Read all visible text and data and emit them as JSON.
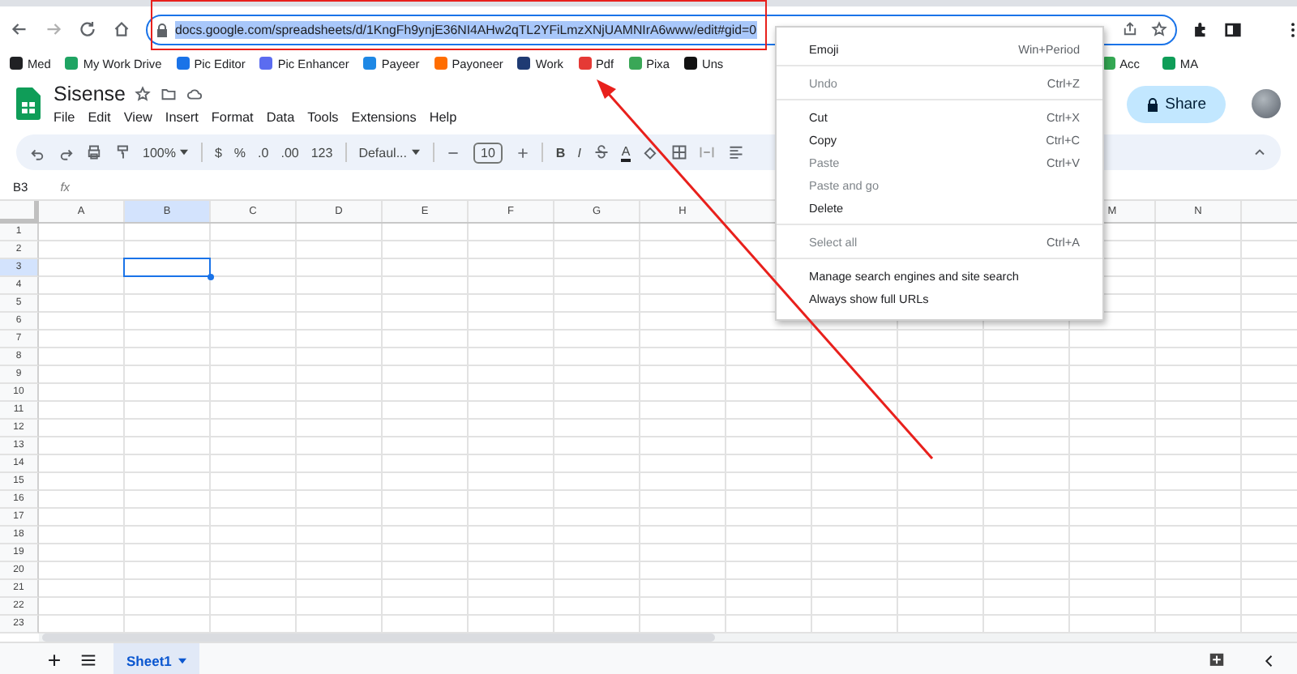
{
  "browser": {
    "url": "docs.google.com/spreadsheets/d/1KngFh9ynjE36NI4AHw2qTL2YFiLmzXNjUAMNIrA6www/edit#gid=0",
    "url_selected": true
  },
  "bookmarks": [
    {
      "label": "Med",
      "color": "#202124"
    },
    {
      "label": "My Work Drive",
      "color": "#1fa463"
    },
    {
      "label": "Pic Editor",
      "color": "#1a73e8"
    },
    {
      "label": "Pic Enhancer",
      "color": "#5b6cf0"
    },
    {
      "label": "Payeer",
      "color": "#1e88e5"
    },
    {
      "label": "Payoneer",
      "color": "#ff6d00"
    },
    {
      "label": "Work",
      "color": "#1f3b73"
    },
    {
      "label": "Pdf",
      "color": "#e53935"
    },
    {
      "label": "Pixa",
      "color": "#3aa757"
    },
    {
      "label": "Uns",
      "color": "#111111"
    }
  ],
  "bookmarks_right": [
    {
      "label": "Acc",
      "color": "#34a853"
    },
    {
      "label": "MA",
      "color": "#0f9d58"
    }
  ],
  "sheets": {
    "title": "Sisense",
    "menus": [
      "File",
      "Edit",
      "View",
      "Insert",
      "Format",
      "Data",
      "Tools",
      "Extensions",
      "Help"
    ],
    "share": "Share"
  },
  "toolbar": {
    "zoom": "100%",
    "currency": "$",
    "percent": "%",
    "decrease_decimals": ".0",
    "increase_decimals": ".00",
    "number_format": "123",
    "font": "Defaul...",
    "font_size": "10",
    "bold": "B",
    "italic": "I",
    "text_color": "A"
  },
  "formula_bar": {
    "name_box": "B3",
    "fx": "fx"
  },
  "grid": {
    "columns": [
      {
        "label": "A",
        "selected": false
      },
      {
        "label": "B",
        "selected": true
      },
      {
        "label": "C",
        "selected": false
      },
      {
        "label": "D",
        "selected": false
      },
      {
        "label": "E",
        "selected": false
      },
      {
        "label": "F",
        "selected": false
      },
      {
        "label": "G",
        "selected": false
      },
      {
        "label": "H",
        "selected": false
      }
    ],
    "columns_right": [
      {
        "label": "M",
        "selected": false
      },
      {
        "label": "N",
        "selected": false
      }
    ],
    "rows": [
      {
        "label": "1",
        "selected": false
      },
      {
        "label": "2",
        "selected": false
      },
      {
        "label": "3",
        "selected": true
      },
      {
        "label": "4",
        "selected": false
      },
      {
        "label": "5",
        "selected": false
      },
      {
        "label": "6",
        "selected": false
      },
      {
        "label": "7",
        "selected": false
      },
      {
        "label": "8",
        "selected": false
      },
      {
        "label": "9",
        "selected": false
      },
      {
        "label": "10",
        "selected": false
      },
      {
        "label": "11",
        "selected": false
      },
      {
        "label": "12",
        "selected": false
      },
      {
        "label": "13",
        "selected": false
      },
      {
        "label": "14",
        "selected": false
      },
      {
        "label": "15",
        "selected": false
      },
      {
        "label": "16",
        "selected": false
      },
      {
        "label": "17",
        "selected": false
      },
      {
        "label": "18",
        "selected": false
      },
      {
        "label": "19",
        "selected": false
      },
      {
        "label": "20",
        "selected": false
      },
      {
        "label": "21",
        "selected": false
      },
      {
        "label": "22",
        "selected": false
      },
      {
        "label": "23",
        "selected": false
      }
    ]
  },
  "sheet_tabs": [
    {
      "label": "Sheet1",
      "selected": true
    }
  ],
  "context_menu": [
    [
      {
        "label": "Emoji",
        "shortcut": "Win+Period",
        "disabled": false
      }
    ],
    [
      {
        "label": "Undo",
        "shortcut": "Ctrl+Z",
        "disabled": true
      }
    ],
    [
      {
        "label": "Cut",
        "shortcut": "Ctrl+X",
        "disabled": false
      },
      {
        "label": "Copy",
        "shortcut": "Ctrl+C",
        "disabled": false
      },
      {
        "label": "Paste",
        "shortcut": "Ctrl+V",
        "disabled": true
      },
      {
        "label": "Paste and go",
        "disabled": true
      },
      {
        "label": "Delete",
        "disabled": false
      }
    ],
    [
      {
        "label": "Select all",
        "shortcut": "Ctrl+A",
        "disabled": true
      }
    ],
    [
      {
        "label": "Manage search engines and site search",
        "disabled": false
      },
      {
        "label": "Always show full URLs",
        "disabled": false
      }
    ]
  ]
}
